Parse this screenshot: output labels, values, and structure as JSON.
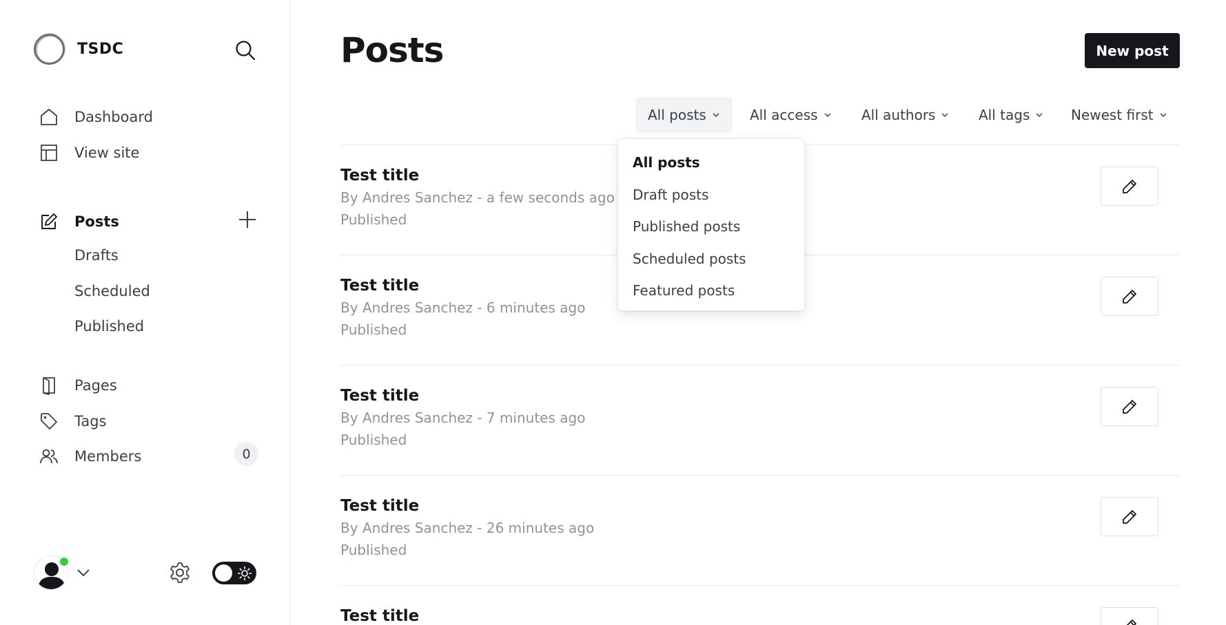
{
  "brand": {
    "name": "TSDC"
  },
  "sidebar": {
    "top_items": [
      {
        "label": "Dashboard",
        "icon": "home-icon"
      },
      {
        "label": "View site",
        "icon": "layout-icon"
      }
    ],
    "posts": {
      "label": "Posts",
      "icon": "edit-icon"
    },
    "post_subitems": [
      {
        "label": "Drafts"
      },
      {
        "label": "Scheduled"
      },
      {
        "label": "Published"
      }
    ],
    "bottom_items": [
      {
        "label": "Pages",
        "icon": "page-icon"
      },
      {
        "label": "Tags",
        "icon": "tag-icon"
      },
      {
        "label": "Members",
        "icon": "members-icon"
      }
    ],
    "members_count": "0"
  },
  "main": {
    "title": "Posts",
    "new_post_label": "New post",
    "filters": [
      {
        "label": "All posts",
        "open": true
      },
      {
        "label": "All access"
      },
      {
        "label": "All authors"
      },
      {
        "label": "All tags"
      },
      {
        "label": "Newest first"
      }
    ],
    "dropdown": {
      "options": [
        "All posts",
        "Draft posts",
        "Published posts",
        "Scheduled posts",
        "Featured posts"
      ],
      "selected": "All posts"
    },
    "posts": [
      {
        "title": "Test title",
        "meta": "By Andres Sanchez - a few seconds ago",
        "status": "Published"
      },
      {
        "title": "Test title",
        "meta": "By Andres Sanchez - 6 minutes ago",
        "status": "Published"
      },
      {
        "title": "Test title",
        "meta": "By Andres Sanchez - 7 minutes ago",
        "status": "Published"
      },
      {
        "title": "Test title",
        "meta": "By Andres Sanchez - 26 minutes ago",
        "status": "Published"
      },
      {
        "title": "Test title"
      }
    ]
  },
  "colors": {
    "accent": "#15171a",
    "online": "#30cf43",
    "muted_text": "#8e9398"
  }
}
